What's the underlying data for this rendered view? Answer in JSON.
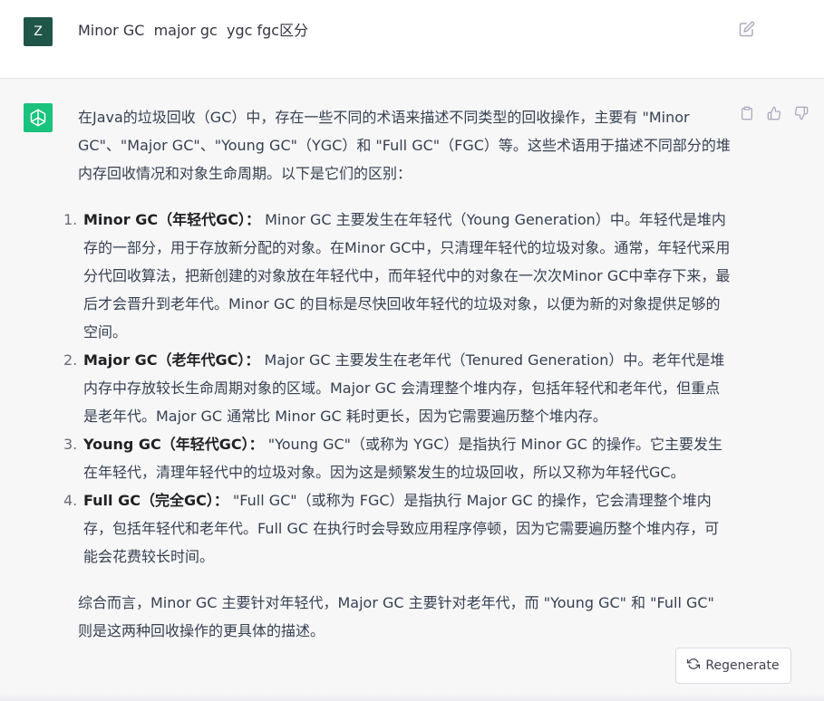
{
  "user": {
    "avatar_letter": "Z",
    "message": "Minor GC  major gc  ygc fgc区分"
  },
  "assistant": {
    "intro": "在Java的垃圾回收（GC）中，存在一些不同的术语来描述不同类型的回收操作，主要有 \"Minor GC\"、\"Major GC\"、\"Young GC\"（YGC）和 \"Full GC\"（FGC）等。这些术语用于描述不同部分的堆内存回收情况和对象生命周期。以下是它们的区别：",
    "items": [
      {
        "num": "1.",
        "title": "Minor GC（年轻代GC）：",
        "text": " Minor GC 主要发生在年轻代（Young Generation）中。年轻代是堆内存的一部分，用于存放新分配的对象。在Minor GC中，只清理年轻代的垃圾对象。通常，年轻代采用分代回收算法，把新创建的对象放在年轻代中，而年轻代中的对象在一次次Minor GC中幸存下来，最后才会晋升到老年代。Minor GC 的目标是尽快回收年轻代的垃圾对象，以便为新的对象提供足够的空间。"
      },
      {
        "num": "2.",
        "title": "Major GC（老年代GC）：",
        "text": " Major GC 主要发生在老年代（Tenured Generation）中。老年代是堆内存中存放较长生命周期对象的区域。Major GC 会清理整个堆内存，包括年轻代和老年代，但重点是老年代。Major GC 通常比 Minor GC 耗时更长，因为它需要遍历整个堆内存。"
      },
      {
        "num": "3.",
        "title": "Young GC（年轻代GC）：",
        "text": " \"Young GC\"（或称为 YGC）是指执行 Minor GC 的操作。它主要发生在年轻代，清理年轻代中的垃圾对象。因为这是频繁发生的垃圾回收，所以又称为年轻代GC。"
      },
      {
        "num": "4.",
        "title": "Full GC（完全GC）：",
        "text": " \"Full GC\"（或称为 FGC）是指执行 Major GC 的操作，它会清理整个堆内存，包括年轻代和老年代。Full GC 在执行时会导致应用程序停顿，因为它需要遍历整个堆内存，可能会花费较长时间。"
      }
    ],
    "summary": "综合而言，Minor GC 主要针对年轻代，Major GC 主要针对老年代，而 \"Young GC\" 和 \"Full GC\" 则是这两种回收操作的更具体的描述。"
  },
  "regenerate_label": "Regenerate",
  "icons": {
    "edit": "edit-icon",
    "copy": "clipboard-icon",
    "like": "thumbs-up-icon",
    "dislike": "thumbs-down-icon",
    "regenerate": "refresh-icon",
    "bot": "openai-logo-icon"
  },
  "colors": {
    "user_avatar": "#1f5648",
    "bot_avatar": "#19c37d"
  }
}
